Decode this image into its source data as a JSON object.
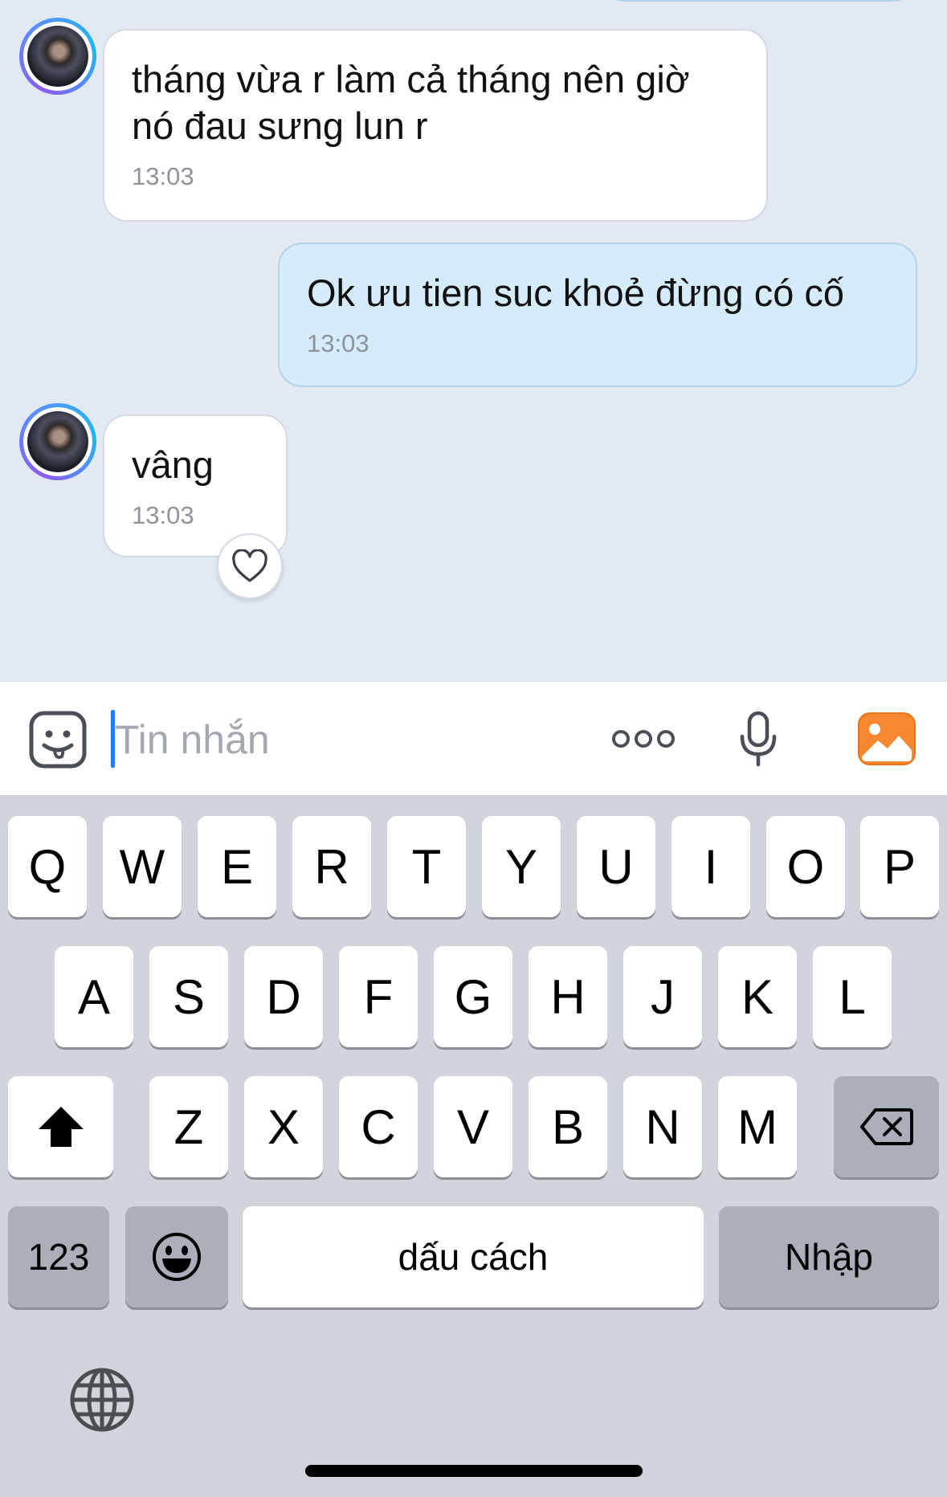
{
  "messages": [
    {
      "direction": "incoming",
      "text_line1": "tháng vừa r làm cả tháng nên giờ",
      "text_line2": "nó đau  sưng lun r",
      "time": "13:03"
    },
    {
      "direction": "outgoing",
      "text": "Ok ưu tien suc khoẻ đừng có cố",
      "time": "13:03"
    },
    {
      "direction": "incoming",
      "text": "vâng",
      "time": "13:03",
      "reaction_icon": "heart-icon"
    }
  ],
  "input_bar": {
    "placeholder": "Tin nhắn",
    "value": "",
    "icons": [
      "sticker-icon",
      "more-icon",
      "microphone-icon",
      "image-icon"
    ],
    "accent_color": "#f7882f"
  },
  "keyboard": {
    "row1": [
      "Q",
      "W",
      "E",
      "R",
      "T",
      "Y",
      "U",
      "I",
      "O",
      "P"
    ],
    "row2": [
      "A",
      "S",
      "D",
      "F",
      "G",
      "H",
      "J",
      "K",
      "L"
    ],
    "row3": [
      "Z",
      "X",
      "C",
      "V",
      "B",
      "N",
      "M"
    ],
    "numbers_label": "123",
    "space_label": "dấu cách",
    "return_label": "Nhập",
    "icons": [
      "shift-icon",
      "backspace-icon",
      "emoji-icon",
      "globe-icon"
    ]
  },
  "colors": {
    "chat_background": "#e2e9f2",
    "incoming_bubble": "#ffffff",
    "outgoing_bubble": "#d4ecfb",
    "caret": "#1a82f5",
    "keyboard_background": "#d1d4da"
  }
}
